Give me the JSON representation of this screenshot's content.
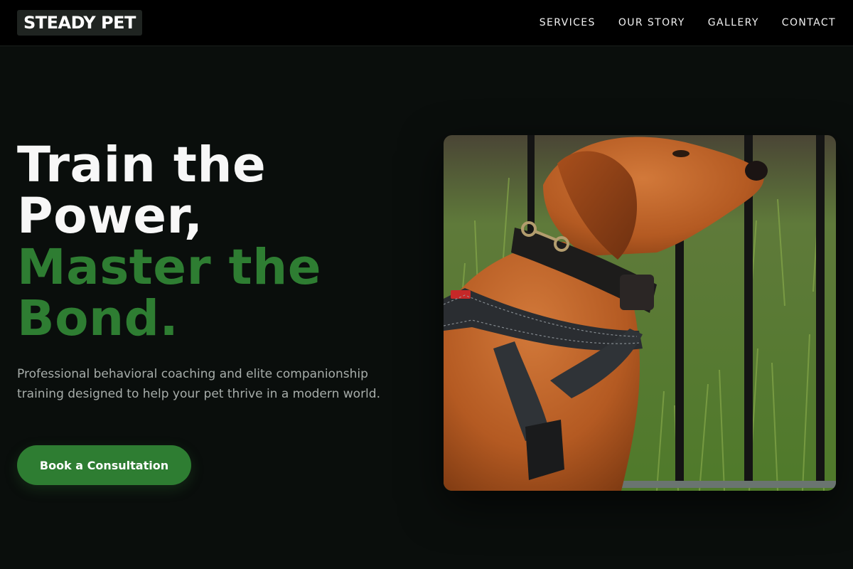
{
  "brand": {
    "logo_text": "STEADY PET"
  },
  "nav": {
    "items": [
      {
        "label": "SERVICES"
      },
      {
        "label": "OUR STORY"
      },
      {
        "label": "GALLERY"
      },
      {
        "label": "CONTACT"
      }
    ]
  },
  "hero": {
    "headline_line1": "Train the",
    "headline_line2": "Power,",
    "headline_line3": "Master the",
    "headline_line4": "Bond.",
    "subtitle": "Professional behavioral coaching and elite companionship training designed to help your pet thrive in a modern world.",
    "cta_label": "Book a Consultation",
    "image_subject": "red labrador retriever wearing a black collar and harness, sitting by a black metal fence on grass"
  },
  "colors": {
    "background": "#0a0e0c",
    "navbar": "#000000",
    "accent_green": "#2e7d32",
    "text_white": "#f7f7f7",
    "text_muted": "#a7adaa"
  }
}
